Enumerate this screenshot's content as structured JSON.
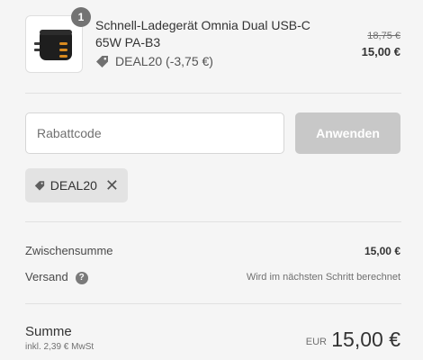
{
  "product": {
    "image_icon": "charger-icon",
    "quantity": "1",
    "title": "Schnell-Ladegerät Omnia Dual USB-C 65W PA-B3",
    "discount_label": "DEAL20 (-3,75 €)",
    "price_original": "18,75 €",
    "price_final": "15,00 €"
  },
  "discount_form": {
    "placeholder": "Rabattcode",
    "value": "",
    "apply_label": "Anwenden"
  },
  "applied_code": {
    "code": "DEAL20",
    "remove_icon": "close-icon"
  },
  "totals": {
    "subtotal_label": "Zwischensumme",
    "subtotal_value": "15,00 €",
    "shipping_label": "Versand",
    "shipping_help_icon": "?",
    "shipping_value": "Wird im nächsten Schritt berechnet",
    "total_label": "Summe",
    "tax_note": "inkl. 2,39 € MwSt",
    "currency": "EUR",
    "total_value": "15,00 €"
  },
  "colors": {
    "background": "#f5f5f5",
    "button_disabled": "#c8c8c8",
    "chip": "#e3e3e3",
    "badge": "#737373"
  }
}
